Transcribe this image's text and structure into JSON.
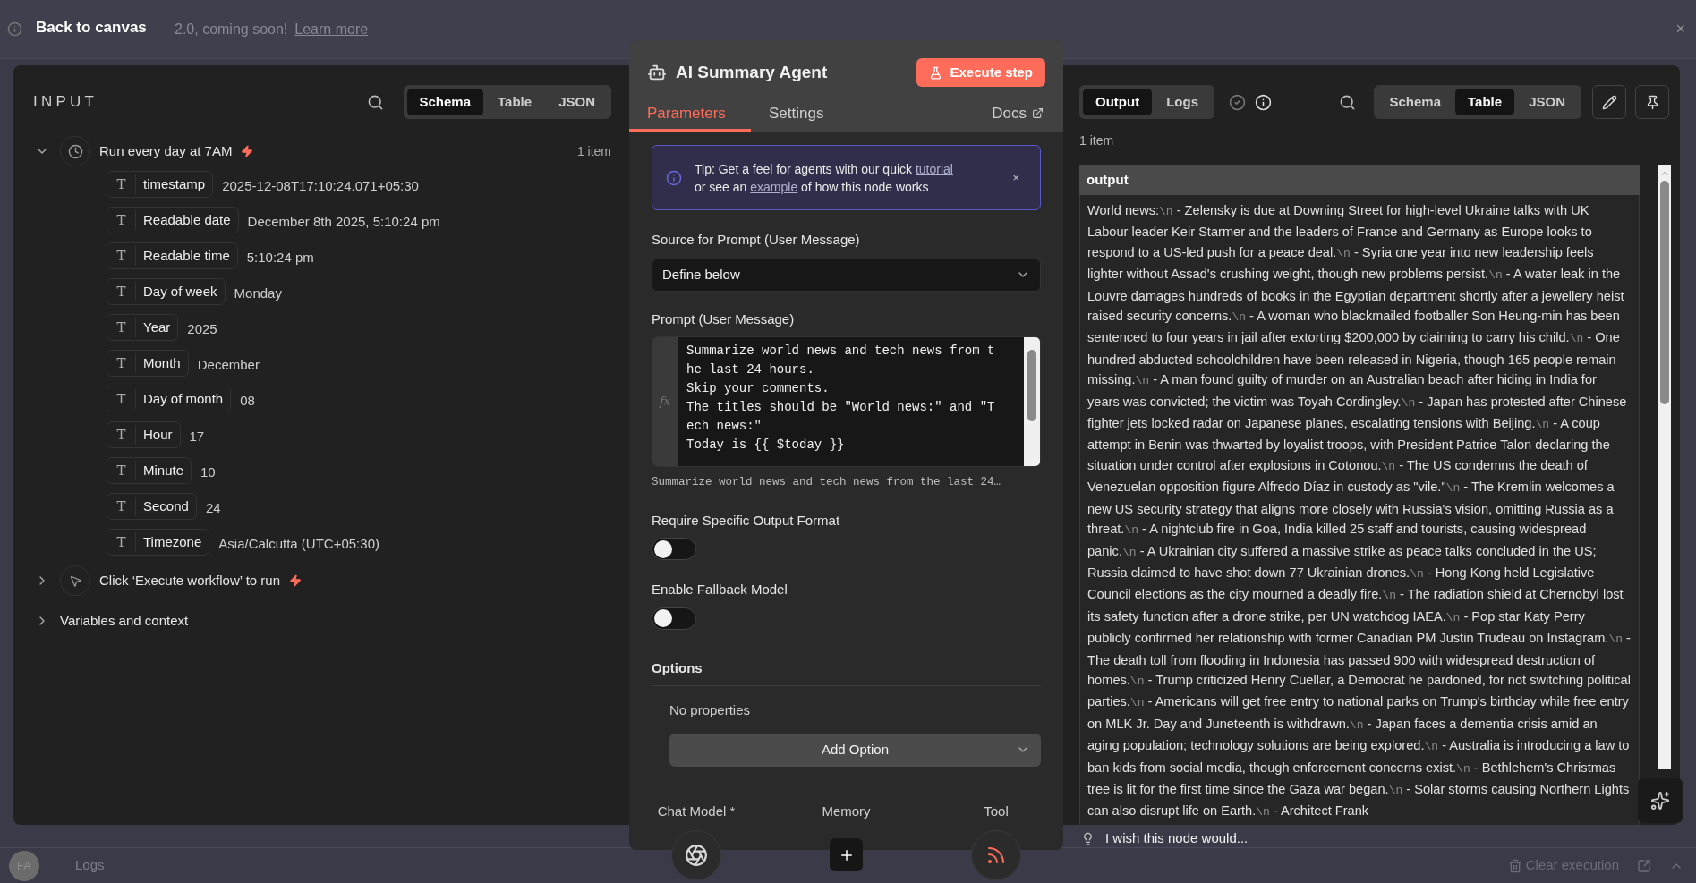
{
  "banner": {
    "back": "Back to canvas",
    "text": "2.0, coming soon!",
    "link": "Learn more",
    "close": "×"
  },
  "input_panel": {
    "title": "INPUT",
    "view_tabs": [
      {
        "label": "Schema",
        "selected": true
      },
      {
        "label": "Table",
        "selected": false
      },
      {
        "label": "JSON",
        "selected": false
      }
    ],
    "nodes": [
      {
        "kind": "schedule",
        "label": "Run every day at 7AM",
        "expanded": true,
        "count": "1 item",
        "fields": [
          {
            "type": "T",
            "name": "timestamp",
            "value": "2025-12-08T17:10:24.071+05:30"
          },
          {
            "type": "T",
            "name": "Readable date",
            "value": "December 8th 2025, 5:10:24 pm"
          },
          {
            "type": "T",
            "name": "Readable time",
            "value": "5:10:24 pm"
          },
          {
            "type": "T",
            "name": "Day of week",
            "value": "Monday"
          },
          {
            "type": "T",
            "name": "Year",
            "value": "2025"
          },
          {
            "type": "T",
            "name": "Month",
            "value": "December"
          },
          {
            "type": "T",
            "name": "Day of month",
            "value": "08"
          },
          {
            "type": "T",
            "name": "Hour",
            "value": "17"
          },
          {
            "type": "T",
            "name": "Minute",
            "value": "10"
          },
          {
            "type": "T",
            "name": "Second",
            "value": "24"
          },
          {
            "type": "T",
            "name": "Timezone",
            "value": "Asia/Calcutta (UTC+05:30)"
          }
        ]
      },
      {
        "kind": "manual",
        "label": "Click ‘Execute workflow’ to run",
        "expanded": false
      }
    ],
    "variables": {
      "label": "Variables and context",
      "expanded": false
    }
  },
  "node_panel": {
    "title": "AI Summary Agent",
    "execute": "Execute step",
    "tabs": [
      {
        "label": "Parameters",
        "selected": true
      },
      {
        "label": "Settings",
        "selected": false
      }
    ],
    "docs": "Docs",
    "tip": {
      "before": "Tip: Get a feel for agents with our quick",
      "link1": "tutorial",
      "middle": "or see an",
      "link2": "example",
      "after": "of how this node works",
      "close": "×"
    },
    "source": {
      "label": "Source for Prompt (User Message)",
      "value": "Define below"
    },
    "prompt": {
      "label": "Prompt (User Message)",
      "gutter": "fx",
      "lines": [
        "Summarize world news and tech news from t",
        "he last 24 hours.",
        "Skip your comments.",
        "The titles should be \"World news:\" and \"T",
        "ech news:\"",
        "Today is {{ $today }}"
      ],
      "hint": "Summarize world news and tech news from the last 24…"
    },
    "toggles": [
      {
        "label": "Require Specific Output Format",
        "on": false
      },
      {
        "label": "Enable Fallback Model",
        "on": false
      }
    ],
    "options": {
      "label": "Options",
      "empty": "No properties",
      "add": "Add Option"
    },
    "sub_nodes": [
      {
        "kind": "model",
        "label": "Chat Model *"
      },
      {
        "kind": "add",
        "label": "Memory"
      },
      {
        "kind": "tool",
        "label": "Tool"
      }
    ]
  },
  "output_panel": {
    "tabs": [
      {
        "label": "Output",
        "selected": true
      },
      {
        "label": "Logs",
        "selected": false
      }
    ],
    "view_tabs": [
      {
        "label": "Schema",
        "selected": false
      },
      {
        "label": "Table",
        "selected": true
      },
      {
        "label": "JSON",
        "selected": false
      }
    ],
    "count": "1 item",
    "table": {
      "columns": [
        "output"
      ],
      "segments": [
        {
          "text": "World news:",
          "separator": "\\n"
        },
        {
          "text": "- Zelensky is due at Downing Street for high-level Ukraine talks with UK Labour leader Keir Starmer and the leaders of France and Germany as Europe looks to respond to a US-led push for a peace deal.",
          "separator": "\\n"
        },
        {
          "text": "- Syria one year into new leadership feels lighter without Assad's crushing weight, though new problems persist.",
          "separator": "\\n"
        },
        {
          "text": "- A water leak in the Louvre damages hundreds of books in the Egyptian department shortly after a jewellery heist raised security concerns.",
          "separator": "\\n"
        },
        {
          "text": "- A woman who blackmailed footballer Son Heung-min has been sentenced to four years in jail after extorting $200,000 by claiming to carry his child.",
          "separator": "\\n"
        },
        {
          "text": "- One hundred abducted schoolchildren have been released in Nigeria, though 165 people remain missing.",
          "separator": "\\n"
        },
        {
          "text": "- A man found guilty of murder on an Australian beach after hiding in India for years was convicted; the victim was Toyah Cordingley.",
          "separator": "\\n"
        },
        {
          "text": "- Japan has protested after Chinese fighter jets locked radar on Japanese planes, escalating tensions with Beijing.",
          "separator": "\\n"
        },
        {
          "text": "- A coup attempt in Benin was thwarted by loyalist troops, with President Patrice Talon declaring the situation under control after explosions in Cotonou.",
          "separator": "\\n"
        },
        {
          "text": "- The US condemns the death of Venezuelan opposition figure Alfredo Díaz in custody as \"vile.\"",
          "separator": "\\n"
        },
        {
          "text": "- The Kremlin welcomes a new US security strategy that aligns more closely with Russia's vision, omitting Russia as a threat.",
          "separator": "\\n"
        },
        {
          "text": "- A nightclub fire in Goa, India killed 25 staff and tourists, causing widespread panic.",
          "separator": "\\n"
        },
        {
          "text": "- A Ukrainian city suffered a massive strike as peace talks concluded in the US; Russia claimed to have shot down 77 Ukrainian drones.",
          "separator": "\\n"
        },
        {
          "text": "- Hong Kong held Legislative Council elections as the city mourned a deadly fire.",
          "separator": "\\n"
        },
        {
          "text": "- The radiation shield at Chernobyl lost its safety function after a drone strike, per UN watchdog IAEA.",
          "separator": "\\n"
        },
        {
          "text": "- Pop star Katy Perry publicly confirmed her relationship with former Canadian PM Justin Trudeau on Instagram.",
          "separator": "\\n"
        },
        {
          "text": "- The death toll from flooding in Indonesia has passed 900 with widespread destruction of homes.",
          "separator": "\\n"
        },
        {
          "text": "- Trump criticized Henry Cuellar, a Democrat he pardoned, for not switching political parties.",
          "separator": "\\n"
        },
        {
          "text": "- Americans will get free entry to national parks on Trump's birthday while free entry on MLK Jr. Day and Juneteenth is withdrawn.",
          "separator": "\\n"
        },
        {
          "text": "- Japan faces a dementia crisis amid an aging population; technology solutions are being explored.",
          "separator": "\\n"
        },
        {
          "text": "- Australia is introducing a law to ban kids from social media, though enforcement concerns exist.",
          "separator": "\\n"
        },
        {
          "text": "- Bethlehem's Christmas tree is lit for the first time since the Gaza war began.",
          "separator": "\\n"
        },
        {
          "text": "- Solar storms causing Northern Lights can also disrupt life on Earth.",
          "separator": "\\n"
        },
        {
          "text": "- Architect Frank"
        }
      ]
    },
    "feedback": "I wish this node would..."
  },
  "footer": {
    "avatar": "FA",
    "logs": "Logs",
    "clear": "Clear execution"
  }
}
